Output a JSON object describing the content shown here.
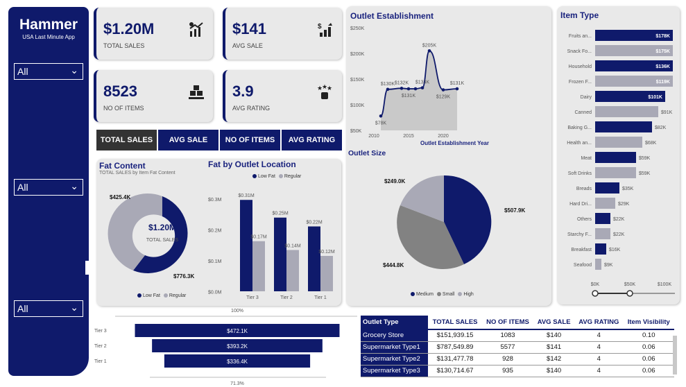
{
  "brand": {
    "title": "Hammer",
    "subtitle": "USA Last Minute App"
  },
  "slicers": [
    "All",
    "All",
    "All"
  ],
  "kpis": [
    {
      "value": "$1.20M",
      "label": "TOTAL SALES",
      "icon": "chart-up-icon"
    },
    {
      "value": "$141",
      "label": "AVG SALE",
      "icon": "dollar-bars-icon"
    },
    {
      "value": "8523",
      "label": "NO OF ITEMS",
      "icon": "boxes-icon"
    },
    {
      "value": "3.9",
      "label": "AVG RATING",
      "icon": "stars-hand-icon"
    }
  ],
  "tabs": [
    "TOTAL SALES",
    "AVG SALE",
    "NO OF ITEMS",
    "AVG RATING"
  ],
  "fat_content": {
    "title": "Fat Content",
    "subtitle": "TOTAL SALES by Item Fat Content",
    "center_value": "$1.20M",
    "center_label": "TOTAL SALES",
    "regular_label": "$425.4K",
    "lowfat_label": "$776.3K",
    "legend": [
      "Low Fat",
      "Regular"
    ]
  },
  "fat_location": {
    "title": "Fat by Outlet Location",
    "legend": [
      "Low Fat",
      "Regular"
    ],
    "y_ticks": [
      "$0.3M",
      "$0.2M",
      "$0.1M",
      "$0.0M"
    ],
    "tiers": [
      "Tier 3",
      "Tier 2",
      "Tier 1"
    ],
    "lowfat_labels": [
      "$0.31M",
      "$0.25M",
      "$0.22M"
    ],
    "regular_labels": [
      "$0.17M",
      "$0.14M",
      "$0.12M"
    ]
  },
  "outlet_establishment": {
    "title": "Outlet Establishment",
    "x_title": "Outlet Establishment Year",
    "y_ticks": [
      "$250K",
      "$200K",
      "$150K",
      "$100K",
      "$50K"
    ],
    "x_ticks": [
      "2010",
      "2015",
      "2020"
    ],
    "point_labels": [
      "$78K",
      "$130K",
      "$132K",
      "$131K",
      "$133K",
      "$205K",
      "$129K",
      "$131K"
    ]
  },
  "outlet_size": {
    "title": "Outlet Size",
    "labels": [
      "$507.9K",
      "$444.8K",
      "$249.0K"
    ],
    "legend": [
      "Medium",
      "Small",
      "High"
    ]
  },
  "item_type": {
    "title": "Item Type",
    "items": [
      {
        "name": "Fruits an...",
        "label": "$178K"
      },
      {
        "name": "Snack Fo...",
        "label": "$175K"
      },
      {
        "name": "Household",
        "label": "$136K"
      },
      {
        "name": "Frozen F...",
        "label": "$119K"
      },
      {
        "name": "Dairy",
        "label": "$101K"
      },
      {
        "name": "Canned",
        "label": "$91K"
      },
      {
        "name": "Baking G...",
        "label": "$82K"
      },
      {
        "name": "Health an...",
        "label": "$68K"
      },
      {
        "name": "Meat",
        "label": "$59K"
      },
      {
        "name": "Soft Drinks",
        "label": "$59K"
      },
      {
        "name": "Breads",
        "label": "$35K"
      },
      {
        "name": "Hard Dri...",
        "label": "$29K"
      },
      {
        "name": "Others",
        "label": "$22K"
      },
      {
        "name": "Starchy F...",
        "label": "$22K"
      },
      {
        "name": "Breakfast",
        "label": "$16K"
      },
      {
        "name": "Seafood",
        "label": "$9K"
      }
    ],
    "x_ticks": [
      "$0K",
      "$50K",
      "$100K"
    ]
  },
  "funnel": {
    "top_label": "100%",
    "bottom_label": "71.3%",
    "tiers": [
      "Tier 3",
      "Tier 2",
      "Tier 1"
    ],
    "values": [
      "$472.1K",
      "$393.2K",
      "$336.4K"
    ]
  },
  "table": {
    "headers": [
      "Outlet Type",
      "TOTAL SALES",
      "NO OF ITEMS",
      "AVG SALE",
      "AVG RATING",
      "Item Visibility"
    ],
    "rows": [
      [
        "Grocery Store",
        "$151,939.15",
        "1083",
        "$140",
        "4",
        "0.10"
      ],
      [
        "Supermarket Type1",
        "$787,549.89",
        "5577",
        "$141",
        "4",
        "0.06"
      ],
      [
        "Supermarket Type2",
        "$131,477.78",
        "928",
        "$142",
        "4",
        "0.06"
      ],
      [
        "Supermarket Type3",
        "$130,714.67",
        "935",
        "$140",
        "4",
        "0.06"
      ]
    ]
  },
  "chart_data": [
    {
      "type": "pie",
      "title": "Fat Content",
      "categories": [
        "Low Fat",
        "Regular"
      ],
      "values": [
        776.3,
        425.4
      ],
      "units": "K$"
    },
    {
      "type": "bar",
      "title": "Fat by Outlet Location",
      "categories": [
        "Tier 3",
        "Tier 2",
        "Tier 1"
      ],
      "series": [
        {
          "name": "Low Fat",
          "values": [
            0.31,
            0.25,
            0.22
          ]
        },
        {
          "name": "Regular",
          "values": [
            0.17,
            0.14,
            0.12
          ]
        }
      ],
      "ylim": [
        0,
        0.3
      ]
    },
    {
      "type": "area",
      "title": "Outlet Establishment",
      "xlabel": "Outlet Establishment Year",
      "x": [
        2011,
        2012,
        2014,
        2015,
        2016,
        2017,
        2018,
        2020,
        2022
      ],
      "y": [
        78,
        130,
        132,
        131,
        131,
        133,
        205,
        129,
        131
      ],
      "ylim": [
        50,
        250
      ]
    },
    {
      "type": "pie",
      "title": "Outlet Size",
      "categories": [
        "Medium",
        "Small",
        "High"
      ],
      "values": [
        507.9,
        444.8,
        249.0
      ]
    },
    {
      "type": "bar",
      "title": "Item Type",
      "categories": [
        "Fruits an...",
        "Snack Fo...",
        "Household",
        "Frozen F...",
        "Dairy",
        "Canned",
        "Baking G...",
        "Health an...",
        "Meat",
        "Soft Drinks",
        "Breads",
        "Hard Dri...",
        "Others",
        "Starchy F...",
        "Breakfast",
        "Seafood"
      ],
      "values": [
        178,
        175,
        136,
        119,
        101,
        91,
        82,
        68,
        59,
        59,
        35,
        29,
        22,
        22,
        16,
        9
      ],
      "xlim": [
        0,
        100
      ]
    },
    {
      "type": "bar",
      "title": "",
      "categories": [
        "Tier 3",
        "Tier 2",
        "Tier 1"
      ],
      "values": [
        472.1,
        393.2,
        336.4
      ]
    }
  ]
}
